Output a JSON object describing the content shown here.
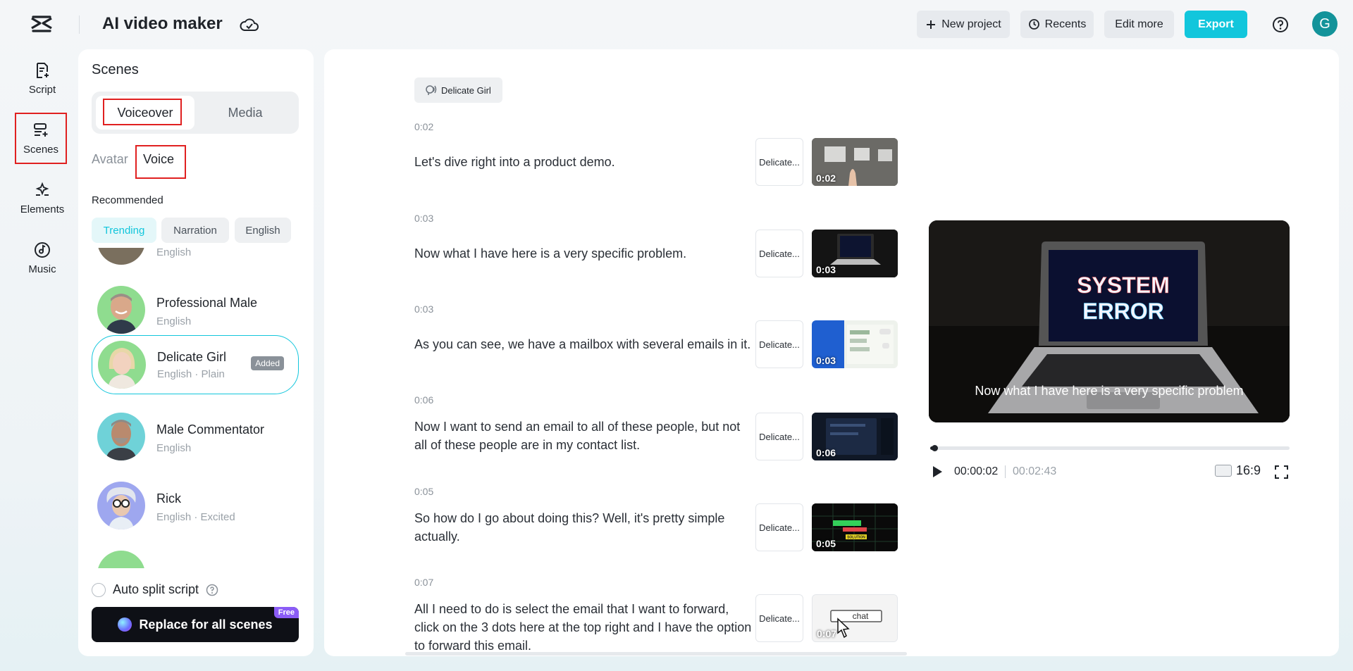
{
  "app": {
    "title": "AI video maker"
  },
  "toolbar": {
    "new_project": "New project",
    "recents": "Recents",
    "edit_more": "Edit more",
    "export": "Export",
    "user_initial": "G"
  },
  "rail": {
    "items": [
      {
        "label": "Script",
        "icon": "script-icon"
      },
      {
        "label": "Scenes",
        "icon": "scenes-icon",
        "active": true
      },
      {
        "label": "Elements",
        "icon": "elements-icon"
      },
      {
        "label": "Music",
        "icon": "music-icon"
      }
    ]
  },
  "scenes_panel": {
    "title": "Scenes",
    "tabs": {
      "voiceover": "Voiceover",
      "media": "Media"
    },
    "sub_tabs": {
      "avatar": "Avatar",
      "voice": "Voice"
    },
    "recommended": "Recommended",
    "chips": [
      "Trending",
      "Narration",
      "English"
    ],
    "voices": [
      {
        "name": "",
        "meta": "English"
      },
      {
        "name": "Professional Male",
        "meta": "English"
      },
      {
        "name": "Delicate Girl",
        "meta": "English · Plain",
        "badge": "Added",
        "selected": true
      },
      {
        "name": "Male Commentator",
        "meta": "English"
      },
      {
        "name": "Rick",
        "meta": "English · Excited"
      }
    ],
    "auto_split": "Auto split script",
    "replace_button": "Replace for all scenes",
    "free_badge": "Free"
  },
  "script": {
    "voice_tag": "Delicate Girl",
    "scenes": [
      {
        "time": "0:02",
        "text": "Let's dive right into a product demo.",
        "voice": "Delicate...",
        "duration": "0:02"
      },
      {
        "time": "0:03",
        "text": "Now what I have here is a very specific problem.",
        "voice": "Delicate...",
        "duration": "0:03"
      },
      {
        "time": "0:03",
        "text": "As you can see, we have a mailbox with several emails in it.",
        "voice": "Delicate...",
        "duration": "0:03"
      },
      {
        "time": "0:06",
        "text": "Now I want to send an email to all of these people, but not all of these people are in my contact list.",
        "voice": "Delicate...",
        "duration": "0:06"
      },
      {
        "time": "0:05",
        "text": "So how do I go about doing this? Well, it's pretty simple actually.",
        "voice": "Delicate...",
        "duration": "0:05"
      },
      {
        "time": "0:07",
        "text": "All I need to do is select the email that I want to forward, click on the 3 dots here at the top right and I have the option to forward this email.",
        "voice": "Delicate...",
        "duration": "0:07"
      }
    ]
  },
  "preview": {
    "screen_line1": "SYSTEM",
    "screen_line2": "ERROR",
    "caption": "Now what I have here is a very specific problem",
    "current_time": "00:00:02",
    "total_time": "00:02:43",
    "progress_fraction": 0.012,
    "aspect_ratio": "16:9"
  },
  "thumb_text": {
    "chat_label": "chat",
    "solution_label": "SOLUTION"
  },
  "colors": {
    "accent": "#12c6dc",
    "highlight_box": "#e02020"
  }
}
